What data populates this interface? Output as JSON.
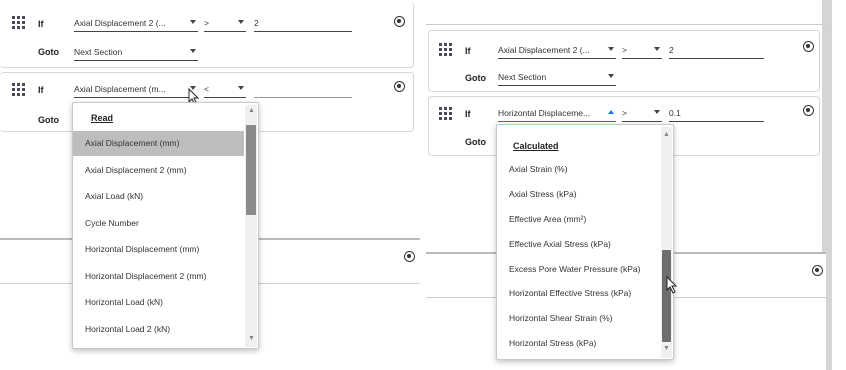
{
  "left": {
    "rule1": {
      "if_label": "If",
      "parameter": "Axial Displacement 2 (...",
      "operator": ">",
      "value": "2",
      "goto_label": "Goto",
      "goto_value": "Next Section"
    },
    "rule2": {
      "if_label": "If",
      "parameter": "Axial Displacement (m...",
      "operator": "<",
      "goto_label": "Goto"
    },
    "dropdown": {
      "heading": "Read",
      "items": [
        "Axial Displacement (mm)",
        "Axial Displacement 2 (mm)",
        "Axial Load (kN)",
        "Cycle Number",
        "Horizontal Displacement (mm)",
        "Horizontal Displacement 2 (mm)",
        "Horizontal Load (kN)",
        "Horizontal Load 2 (kN)"
      ],
      "highlighted_index": 0
    }
  },
  "right": {
    "rule1": {
      "if_label": "If",
      "parameter": "Axial Displacement 2 (...",
      "operator": ">",
      "value": "2",
      "goto_label": "Goto",
      "goto_value": "Next Section"
    },
    "rule2": {
      "if_label": "If",
      "parameter": "Horizontal Displaceme...",
      "operator": ">",
      "value": "0.1",
      "goto_label": "Goto"
    },
    "dropdown": {
      "heading": "Calculated",
      "items": [
        "Axial Strain (%)",
        "Axial Stress (kPa)",
        "Effective Area (mm²)",
        "Effective Axial Stress (kPa)",
        "Excess Pore Water Pressure (kPa)",
        "Horizontal Effective Stress (kPa)",
        "Horizontal Shear Strain (%)",
        "Horizontal Stress (kPa)"
      ]
    }
  },
  "colors": {
    "accent": "#1a73e8",
    "highlight": "#bdbdbd",
    "border": "#d6d6d6"
  }
}
